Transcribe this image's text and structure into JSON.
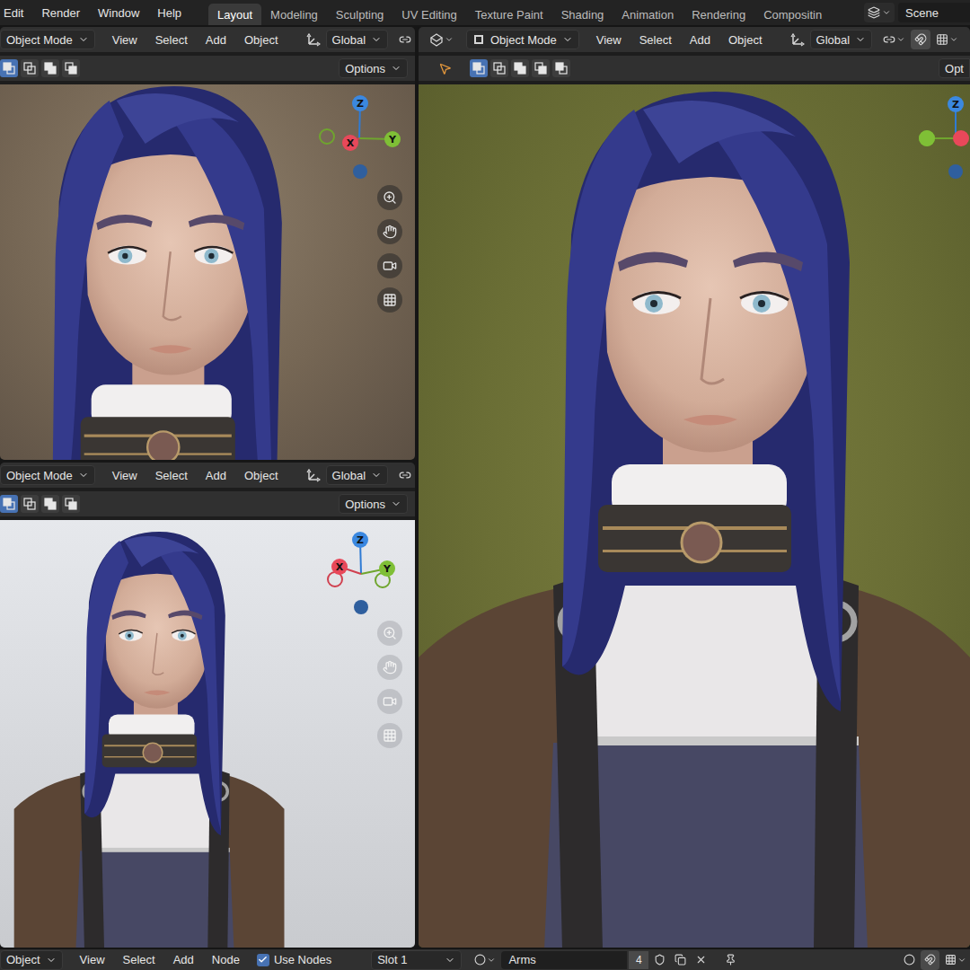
{
  "top_menu": [
    "Edit",
    "Render",
    "Window",
    "Help"
  ],
  "workspaces": [
    {
      "label": "Layout",
      "selected": true
    },
    {
      "label": "Modeling",
      "selected": false
    },
    {
      "label": "Sculpting",
      "selected": false
    },
    {
      "label": "UV Editing",
      "selected": false
    },
    {
      "label": "Texture Paint",
      "selected": false
    },
    {
      "label": "Shading",
      "selected": false
    },
    {
      "label": "Animation",
      "selected": false
    },
    {
      "label": "Rendering",
      "selected": false
    },
    {
      "label": "Compositin",
      "selected": false
    }
  ],
  "scene": "Scene",
  "viewports": [
    {
      "mode": "Object Mode",
      "menus": [
        "View",
        "Select",
        "Add",
        "Object"
      ],
      "orientation": "Global",
      "options": "Options",
      "select_modes": [
        {
          "selected": true
        },
        {
          "selected": false
        },
        {
          "selected": false
        },
        {
          "selected": false
        }
      ],
      "gizmo": {
        "x": "X",
        "y": "Y",
        "z": "Z"
      }
    },
    {
      "mode": "Object Mode",
      "menus": [
        "View",
        "Select",
        "Add",
        "Object"
      ],
      "orientation": "Global",
      "options": "Options",
      "select_modes": [
        {
          "selected": true
        },
        {
          "selected": false
        },
        {
          "selected": false
        },
        {
          "selected": false
        }
      ],
      "gizmo": {
        "x": "X",
        "y": "Y",
        "z": "Z"
      }
    },
    {
      "mode": "Object Mode",
      "menus": [
        "View",
        "Select",
        "Add",
        "Object"
      ],
      "orientation": "Global",
      "options": "Opt",
      "select_modes": [
        {
          "selected": true
        },
        {
          "selected": false
        },
        {
          "selected": false
        },
        {
          "selected": false
        },
        {
          "selected": false
        }
      ],
      "gizmo": {
        "z": "Z"
      }
    }
  ],
  "node_header": {
    "mode": "Object",
    "menus": [
      "View",
      "Select",
      "Add",
      "Node"
    ],
    "use_nodes": {
      "label": "Use Nodes",
      "checked": true
    },
    "slot": "Slot 1",
    "material": "Arms",
    "users": "4"
  }
}
